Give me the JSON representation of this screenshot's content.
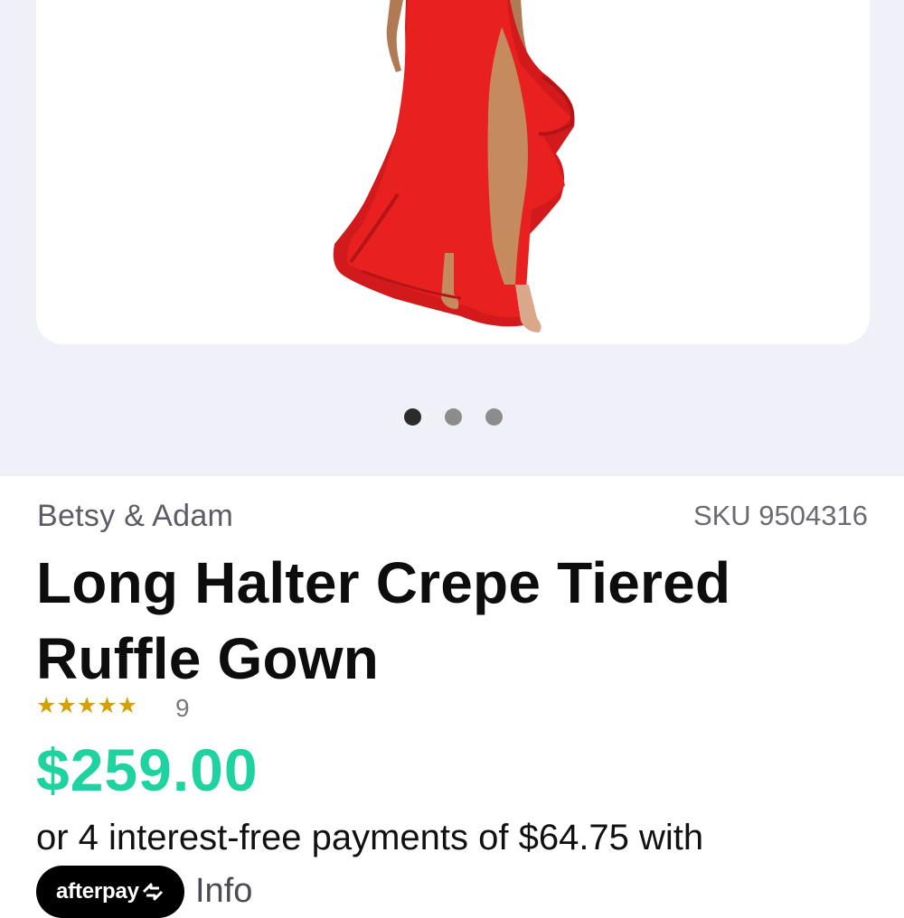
{
  "gallery": {
    "image_alt": "Model wearing red long halter crepe tiered ruffle gown",
    "dots_total": 3,
    "active_index": 0
  },
  "product": {
    "brand": "Betsy & Adam",
    "sku": "SKU 9504316",
    "title": "Long Halter Crepe Tiered Ruffle Gown",
    "rating": {
      "stars_text": "★★★★★",
      "stars_value": 5,
      "count": "9"
    },
    "price": "$259.00",
    "installments": "or 4 interest-free payments of $64.75 with",
    "afterpay": {
      "label": "afterpay",
      "icon": "afterpay-arrows-icon"
    },
    "info_link": "Info"
  },
  "colors": {
    "price_green": "#1fd3a0",
    "star_gold": "#d4a007",
    "gallery_bg": "#f0f1f8",
    "dress_red": "#e8201f"
  }
}
